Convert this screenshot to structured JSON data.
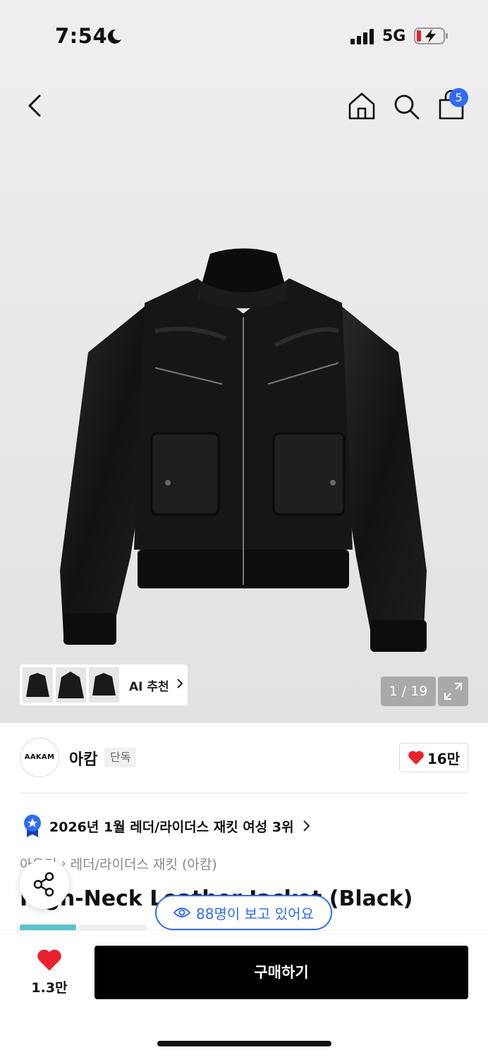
{
  "status_bar": {
    "time": "7:54",
    "network": "5G"
  },
  "nav": {
    "cart_count": "5"
  },
  "gallery": {
    "ai_label": "AI 추천",
    "counter": "1 / 19"
  },
  "brand": {
    "logo_text": "AAKAM",
    "name": "아캄",
    "tag": "단독",
    "likes": "16만"
  },
  "ranking": {
    "text": "2026년 1월 레더/라이더스 재킷 여성 3위"
  },
  "breadcrumb": {
    "items": [
      "아우터",
      "레더/라이더스 재킷 (아캄)"
    ]
  },
  "product": {
    "title": "High-Neck Leather Jacket (Black)"
  },
  "viewers": {
    "text": "88명이 보고 있어요"
  },
  "bottom": {
    "fav_count": "1.3만",
    "buy_label": "구매하기"
  },
  "colors": {
    "accent": "#2f6cf6",
    "heart": "#e8212d",
    "tag_teal": "#5bc4c8"
  },
  "icons": [
    "moon-icon",
    "signal-icon",
    "battery-charging-icon",
    "back-icon",
    "home-icon",
    "search-icon",
    "bag-icon",
    "chevron-right-icon",
    "expand-icon",
    "heart-icon",
    "ranking-medal-icon",
    "share-icon",
    "eye-icon"
  ]
}
